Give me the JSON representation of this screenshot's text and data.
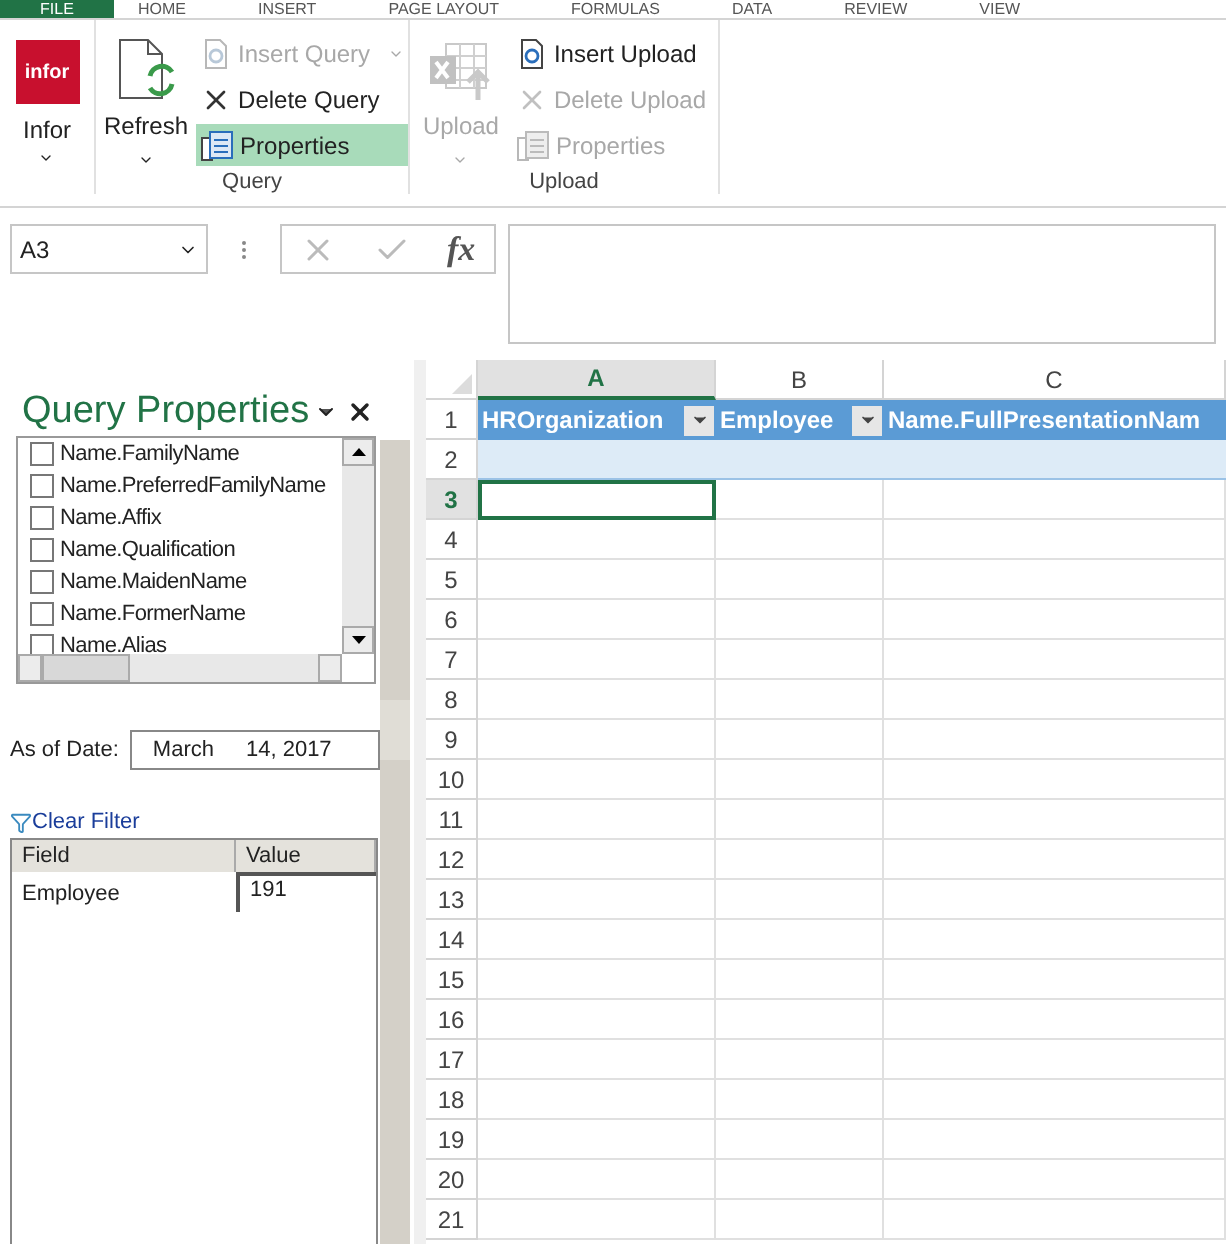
{
  "ribbon_tabs": [
    {
      "label": "FILE",
      "selected": true
    },
    {
      "label": "HOME",
      "selected": false
    },
    {
      "label": "INSERT",
      "selected": false
    },
    {
      "label": "PAGE LAYOUT",
      "selected": false
    },
    {
      "label": "FORMULAS",
      "selected": false
    },
    {
      "label": "DATA",
      "selected": false
    },
    {
      "label": "REVIEW",
      "selected": false
    },
    {
      "label": "VIEW",
      "selected": false
    }
  ],
  "infor": {
    "logo": "infor",
    "label": "Infor"
  },
  "groups": [
    {
      "label": "Query",
      "large": {
        "label": "Refresh",
        "disabled": false
      },
      "items": [
        {
          "kind": "insert",
          "label": "Insert Query",
          "disabled": true,
          "selected": false,
          "has_menu": true
        },
        {
          "kind": "delete",
          "label": "Delete Query",
          "disabled": false,
          "selected": false,
          "has_menu": false
        },
        {
          "kind": "properties",
          "label": "Properties",
          "disabled": false,
          "selected": true,
          "has_menu": false
        }
      ]
    },
    {
      "label": "Upload",
      "large": {
        "label": "Upload",
        "disabled": true
      },
      "items": [
        {
          "kind": "insert",
          "label": "Insert Upload",
          "disabled": false,
          "selected": false,
          "has_menu": false
        },
        {
          "kind": "delete",
          "label": "Delete Upload",
          "disabled": true,
          "selected": false,
          "has_menu": false
        },
        {
          "kind": "properties",
          "label": "Properties",
          "disabled": true,
          "selected": false,
          "has_menu": false
        }
      ]
    }
  ],
  "formula_bar": {
    "name_box": "A3",
    "fx": "fx"
  },
  "panel": {
    "title": "Query Properties",
    "fields": [
      {
        "label": "Name.FamilyName",
        "checked": false
      },
      {
        "label": "Name.PreferredFamilyName",
        "checked": false
      },
      {
        "label": "Name.Affix",
        "checked": false
      },
      {
        "label": "Name.Qualification",
        "checked": false
      },
      {
        "label": "Name.MaidenName",
        "checked": false
      },
      {
        "label": "Name.FormerName",
        "checked": false
      },
      {
        "label": "Name.Alias",
        "checked": false
      }
    ],
    "as_of_date": {
      "label": "As of Date:",
      "month": "March",
      "day": "14, 2017"
    },
    "clear_filter": "Clear Filter",
    "filter_table": {
      "columns": [
        "Field",
        "Value"
      ],
      "rows": [
        [
          "Employee",
          "191"
        ]
      ]
    }
  },
  "sheet": {
    "columns": [
      {
        "label": "A",
        "header": "HROrganization",
        "selected": true
      },
      {
        "label": "B",
        "header": "Employee",
        "selected": false
      },
      {
        "label": "C",
        "header": "Name.FullPresentationNam",
        "selected": false
      }
    ],
    "rows": [
      {
        "number": "1",
        "kind": "header",
        "selected": false
      },
      {
        "number": "2",
        "kind": "band",
        "selected": false
      },
      {
        "number": "3",
        "kind": "plain",
        "selected": true
      },
      {
        "number": "4",
        "kind": "plain",
        "selected": false
      },
      {
        "number": "5",
        "kind": "plain",
        "selected": false
      },
      {
        "number": "6",
        "kind": "plain",
        "selected": false
      },
      {
        "number": "7",
        "kind": "plain",
        "selected": false
      },
      {
        "number": "8",
        "kind": "plain",
        "selected": false
      },
      {
        "number": "9",
        "kind": "plain",
        "selected": false
      },
      {
        "number": "10",
        "kind": "plain",
        "selected": false
      },
      {
        "number": "11",
        "kind": "plain",
        "selected": false
      },
      {
        "number": "12",
        "kind": "plain",
        "selected": false
      },
      {
        "number": "13",
        "kind": "plain",
        "selected": false
      },
      {
        "number": "14",
        "kind": "plain",
        "selected": false
      },
      {
        "number": "15",
        "kind": "plain",
        "selected": false
      },
      {
        "number": "16",
        "kind": "plain",
        "selected": false
      },
      {
        "number": "17",
        "kind": "plain",
        "selected": false
      },
      {
        "number": "18",
        "kind": "plain",
        "selected": false
      },
      {
        "number": "19",
        "kind": "plain",
        "selected": false
      },
      {
        "number": "20",
        "kind": "plain",
        "selected": false
      },
      {
        "number": "21",
        "kind": "plain",
        "selected": false
      }
    ]
  }
}
